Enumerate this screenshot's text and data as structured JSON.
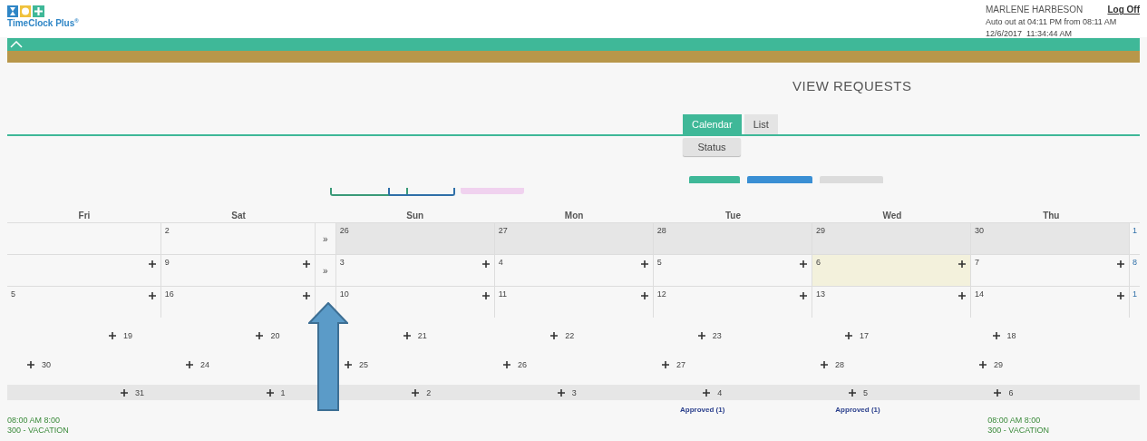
{
  "logo": {
    "text": "TimeClock Plus$^{®}$"
  },
  "user": {
    "name": "MARLENE HARBESON",
    "logoff": "Log Off",
    "auto_out": "Auto out at 04:11 PM from 08:11 AM",
    "datetime": "12/6/2017  11:34:44 AM"
  },
  "page_title": "VIEW REQUESTS",
  "tabs": [
    {
      "label": "Calendar",
      "selected": true
    },
    {
      "label": "List",
      "selected": false
    }
  ],
  "status_button": "Status",
  "calendar": {
    "left_days": [
      "Fri",
      "Sat"
    ],
    "right_days": [
      "Sun",
      "Mon",
      "Tue",
      "Wed",
      "Thu"
    ],
    "weeks": [
      {
        "expander": "»",
        "left": [
          {
            "add": false,
            "past": false,
            "today": false
          },
          {
            "day": "2",
            "add": false,
            "past": false,
            "today": false
          }
        ],
        "right": [
          {
            "day": "26",
            "add": false,
            "past": true,
            "today": false
          },
          {
            "day": "27",
            "add": false,
            "past": true,
            "today": false
          },
          {
            "day": "28",
            "add": false,
            "past": true,
            "today": false
          },
          {
            "day": "29",
            "add": false,
            "past": true,
            "today": false
          },
          {
            "day": "30",
            "add": false,
            "past": true,
            "today": false
          }
        ],
        "edge": "1"
      },
      {
        "expander": "»",
        "left": [
          {
            "add": true,
            "past": false,
            "today": false
          },
          {
            "day": "9",
            "add": true,
            "past": false,
            "today": false
          }
        ],
        "right": [
          {
            "day": "3",
            "add": true,
            "past": false,
            "today": false
          },
          {
            "day": "4",
            "add": true,
            "past": false,
            "today": false
          },
          {
            "day": "5",
            "add": true,
            "past": false,
            "today": false
          },
          {
            "day": "6",
            "add": true,
            "past": false,
            "today": true
          },
          {
            "day": "7",
            "add": true,
            "past": false,
            "today": false
          }
        ],
        "edge": "8"
      },
      {
        "left": [
          {
            "day": "5",
            "add": true,
            "past": false,
            "today": false
          },
          {
            "day": "16",
            "add": true,
            "past": false,
            "today": false
          }
        ],
        "right": [
          {
            "day": "10",
            "add": true,
            "past": false,
            "today": false
          },
          {
            "day": "11",
            "add": true,
            "past": false,
            "today": false
          },
          {
            "day": "12",
            "add": true,
            "past": false,
            "today": false
          },
          {
            "day": "13",
            "add": true,
            "past": false,
            "today": false
          },
          {
            "day": "14",
            "add": true,
            "past": false,
            "today": false
          }
        ],
        "edge": "1"
      }
    ],
    "lower_rows": [
      {
        "band": false,
        "days": [
          "19",
          "20",
          "21",
          "22",
          "23",
          "17",
          "18"
        ]
      },
      {
        "band": false,
        "days": [
          "30",
          "24",
          "25",
          "26",
          "27",
          "28",
          "29"
        ]
      },
      {
        "band": true,
        "days": [
          "31",
          "1",
          "2",
          "3",
          "4",
          "5",
          "6"
        ]
      }
    ],
    "notes": [
      "Approved (1)",
      "Approved (1)"
    ],
    "entries": [
      {
        "time": "08:00 AM 8:00",
        "code": "300 - VACATION"
      },
      {
        "time": "08:00 AM 8:00",
        "code": "300 - VACATION"
      }
    ]
  }
}
